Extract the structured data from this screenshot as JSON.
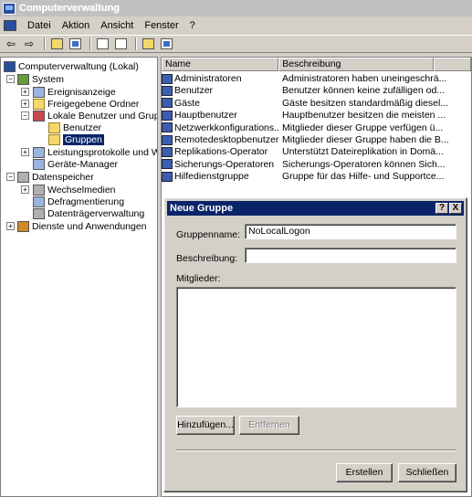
{
  "window": {
    "title": "Computerverwaltung"
  },
  "menu": [
    "Datei",
    "Aktion",
    "Ansicht",
    "Fenster",
    "?"
  ],
  "toolbar": {
    "back": "⇦",
    "forward": "⇨"
  },
  "tree": {
    "root": "Computerverwaltung (Lokal)",
    "system": "System",
    "ereignis": "Ereignisanzeige",
    "freigaben": "Freigegebene Ordner",
    "lokale": "Lokale Benutzer und Gruppen",
    "benutzer": "Benutzer",
    "gruppen": "Gruppen",
    "leistung": "Leistungsprotokolle und Warnungen",
    "geraete": "Geräte-Manager",
    "datenspeicher": "Datenspeicher",
    "wechsel": "Wechselmedien",
    "defrag": "Defragmentierung",
    "datentraeger": "Datenträgerverwaltung",
    "dienste": "Dienste und Anwendungen"
  },
  "list": {
    "headers": [
      "Name",
      "Beschreibung"
    ],
    "rows": [
      {
        "name": "Administratoren",
        "desc": "Administratoren haben uneingeschrä..."
      },
      {
        "name": "Benutzer",
        "desc": "Benutzer können keine zufälligen od..."
      },
      {
        "name": "Gäste",
        "desc": "Gäste besitzen standardmäßig diesel..."
      },
      {
        "name": "Hauptbenutzer",
        "desc": "Hauptbenutzer besitzen die meisten ..."
      },
      {
        "name": "Netzwerkkonfigurations...",
        "desc": "Mitglieder dieser Gruppe verfügen ü..."
      },
      {
        "name": "Remotedesktopbenutzer",
        "desc": "Mitglieder dieser Gruppe haben die B..."
      },
      {
        "name": "Replikations-Operator",
        "desc": "Unterstützt Dateireplikation in Domä..."
      },
      {
        "name": "Sicherungs-Operatoren",
        "desc": "Sicherungs-Operatoren können Sich..."
      },
      {
        "name": "Hilfedienstgruppe",
        "desc": "Gruppe für das Hilfe- und Supportce..."
      }
    ]
  },
  "dialog": {
    "title": "Neue Gruppe",
    "help_btn": "?",
    "close_btn": "X",
    "name_label": "Gruppenname:",
    "name_value": "NoLocalLogon",
    "desc_label": "Beschreibung:",
    "desc_value": "",
    "members_label": "Mitglieder:",
    "add_btn": "Hinzufügen...",
    "remove_btn": "Entfernen",
    "create_btn": "Erstellen",
    "close_action_btn": "Schließen"
  }
}
